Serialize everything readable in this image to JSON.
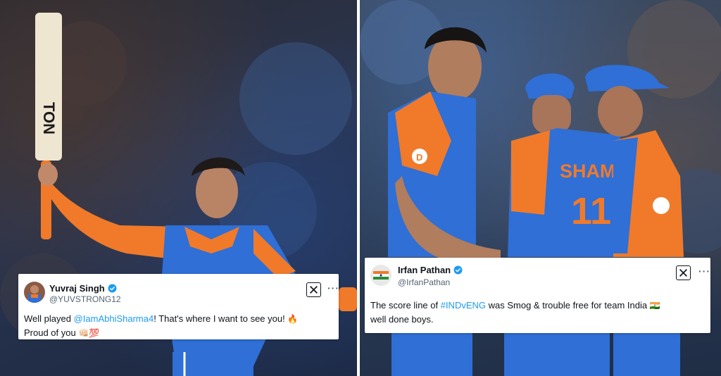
{
  "tweets": [
    {
      "display_name": "Yuvraj Singh",
      "handle": "@YUVSTRONG12",
      "text_parts": {
        "pre": "Well played ",
        "mention": "@IamAbhiSharma4",
        "post": "! That's where I want to see you! ",
        "emoji1": "🔥",
        "line2": "Proud of you ",
        "emoji2": "👊🏻💯"
      },
      "verified": true,
      "logo_icon": "x-logo-icon",
      "more_icon": "more-dots-icon"
    },
    {
      "display_name": "Irfan Pathan",
      "handle": "@IrfanPathan",
      "text_parts": {
        "pre": "The score line of ",
        "hashtag": "#INDvENG",
        "post": " was Smog & trouble free for team India ",
        "flag": "🇮🇳",
        "line2": "well done boys."
      },
      "verified": true,
      "logo_icon": "x-logo-icon",
      "more_icon": "more-dots-icon"
    }
  ],
  "photo_text": {
    "bat_brand": "TON",
    "jersey_name": "SHAMI",
    "jersey_number": "11",
    "sponsor_logo": "D"
  },
  "colors": {
    "jersey_blue": "#2f6fd6",
    "jersey_orange": "#f07a2a",
    "verified_blue": "#1d9bf0",
    "mention_blue": "#1d9bf0"
  }
}
